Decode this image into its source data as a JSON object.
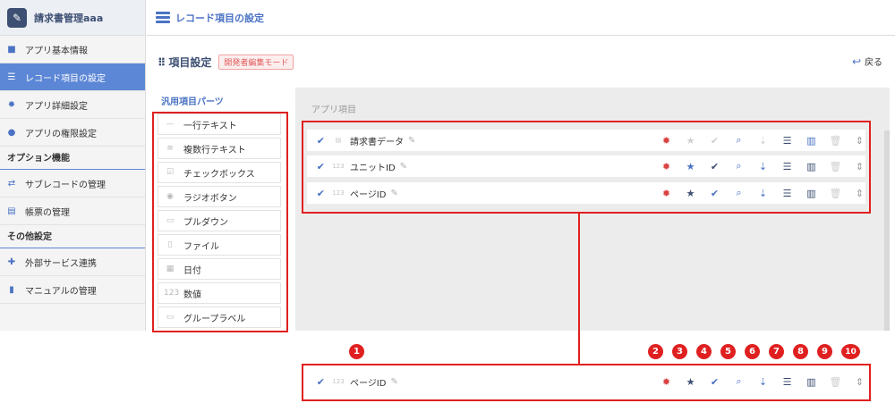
{
  "app": {
    "name": "請求書管理aaa",
    "logo_icon": "document-icon"
  },
  "topbar": {
    "title": "レコード項目の設定"
  },
  "sidebar": {
    "items": [
      {
        "label": "アプリ基本情報",
        "icon": "i"
      },
      {
        "label": "レコード項目の設定",
        "icon": "☰"
      },
      {
        "label": "アプリ詳細設定",
        "icon": "✹"
      },
      {
        "label": "アプリの権限設定",
        "icon": "👥"
      }
    ],
    "section_options": "オプション機能",
    "option_items": [
      {
        "label": "サブレコードの管理",
        "icon": "⇄"
      },
      {
        "label": "帳票の管理",
        "icon": "▤"
      }
    ],
    "section_other": "その他設定",
    "other_items": [
      {
        "label": "外部サービス連携",
        "icon": "✚"
      },
      {
        "label": "マニュアルの管理",
        "icon": "📖"
      }
    ]
  },
  "main": {
    "section_title": "項目設定",
    "dev_mode_badge": "開発者編集モード",
    "back_label": "戻る",
    "parts_label": "汎用項目パーツ",
    "parts": [
      {
        "label": "一行テキスト",
        "icon": "—"
      },
      {
        "label": "複数行テキスト",
        "icon": "≡"
      },
      {
        "label": "チェックボックス",
        "icon": "☑"
      },
      {
        "label": "ラジオボタン",
        "icon": "◉"
      },
      {
        "label": "プルダウン",
        "icon": "▭"
      },
      {
        "label": "ファイル",
        "icon": "▯"
      },
      {
        "label": "日付",
        "icon": "▦"
      },
      {
        "label": "数値",
        "icon": "123"
      },
      {
        "label": "グループラベル",
        "icon": "▭"
      }
    ],
    "app_items_label": "アプリ項目",
    "fields": [
      {
        "name": "請求書データ",
        "type_icon": "▤"
      },
      {
        "name": "ユニットID",
        "type_icon": "123"
      },
      {
        "name": "ページID",
        "type_icon": "123"
      }
    ],
    "detail_field": {
      "name": "ページID",
      "type_icon": "123"
    }
  },
  "callouts": [
    "1",
    "2",
    "3",
    "4",
    "5",
    "6",
    "7",
    "8",
    "9",
    "10"
  ],
  "colors": {
    "accent": "#4a72c4",
    "annotation": "#e02020",
    "gear": "#d94040"
  }
}
